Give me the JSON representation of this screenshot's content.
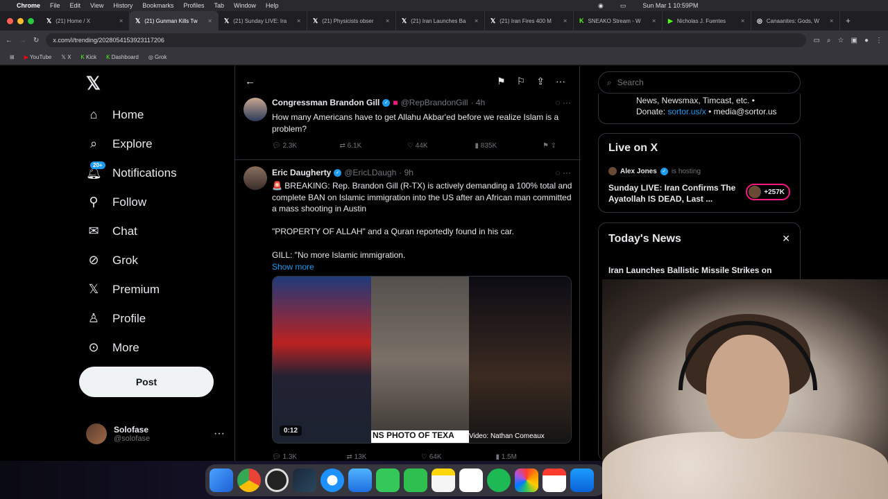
{
  "menubar": {
    "app": "Chrome",
    "items": [
      "File",
      "Edit",
      "View",
      "History",
      "Bookmarks",
      "Profiles",
      "Tab",
      "Window",
      "Help"
    ],
    "clock": "Sun Mar 1  10:59PM"
  },
  "tabs": [
    {
      "label": "(21) Home / X",
      "active": false
    },
    {
      "label": "(21) Gunman Kills Tw",
      "active": true
    },
    {
      "label": "(21) Sunday LIVE: Ira",
      "active": false
    },
    {
      "label": "(21) Physicists obser",
      "active": false
    },
    {
      "label": "(21) Iran Launches Ba",
      "active": false
    },
    {
      "label": "(21) Iran Fires 400 M",
      "active": false
    },
    {
      "label": "SNEAKO Stream - W",
      "active": false
    },
    {
      "label": "Nicholas J. Fuentes",
      "active": false
    },
    {
      "label": "Canaanites: Gods, W",
      "active": false
    }
  ],
  "address": {
    "url": "x.com/i/trending/2028054153923117206"
  },
  "bookmarks": [
    "YouTube",
    "X",
    "Kick",
    "Dashboard",
    "Grok"
  ],
  "nav": {
    "items": [
      {
        "label": "Home",
        "icon": "home-icon"
      },
      {
        "label": "Explore",
        "icon": "search-icon"
      },
      {
        "label": "Notifications",
        "icon": "bell-icon",
        "badge": "20+"
      },
      {
        "label": "Follow",
        "icon": "person-add-icon"
      },
      {
        "label": "Chat",
        "icon": "mail-icon"
      },
      {
        "label": "Grok",
        "icon": "grok-icon"
      },
      {
        "label": "Premium",
        "icon": "x-icon"
      },
      {
        "label": "Profile",
        "icon": "person-icon"
      },
      {
        "label": "More",
        "icon": "more-circle-icon"
      }
    ],
    "post_label": "Post",
    "account": {
      "name": "Solofase",
      "handle": "@solofase"
    }
  },
  "tweets": [
    {
      "name": "Congressman Brandon Gill",
      "handle": "@RepBrandonGill",
      "time": "· 4h",
      "text": "How many Americans have to get Allahu Akbar'ed before we realize Islam is a problem?",
      "stats": {
        "replies": "2.3K",
        "reposts": "6.1K",
        "likes": "44K",
        "views": "835K"
      }
    },
    {
      "name": "Eric Daugherty",
      "handle": "@EricLDaugh",
      "time": "· 9h",
      "para1": "🚨 BREAKING: Rep. Brandon Gill (R-TX) is actively demanding a 100% total and complete BAN on Islamic immigration into the US after an African man committed a mass shooting in Austin",
      "para2": "\"PROPERTY OF ALLAH\" and a Quran reportedly found in his car.",
      "para3": "GILL: \"No more Islamic immigration.",
      "show_more": "Show more",
      "media": {
        "duration": "0:12",
        "banner": "NS PHOTO OF TEXA",
        "credit": "Video: Nathan Comeaux"
      },
      "stats": {
        "replies": "1.3K",
        "reposts": "13K",
        "likes": "64K",
        "views": "1.5M"
      }
    }
  ],
  "right": {
    "search_placeholder": "Search",
    "spaces_text": "News, Newsmax, Timcast, etc. •",
    "spaces_donate": "Donate:",
    "spaces_link": "sortor.us/x",
    "spaces_email": "• media@sortor.us",
    "live": {
      "title": "Live on X",
      "host": "Alex Jones",
      "status": "is hosting",
      "stream_title": "Sunday LIVE: Iran Confirms The Ayatollah IS DEAD, Last ...",
      "listeners": "+257K"
    },
    "news": {
      "title": "Today's News",
      "item": "Iran Launches Ballistic Missile Strikes on"
    }
  },
  "colors": {
    "accent": "#1d9bf0",
    "live": "#f91880"
  }
}
